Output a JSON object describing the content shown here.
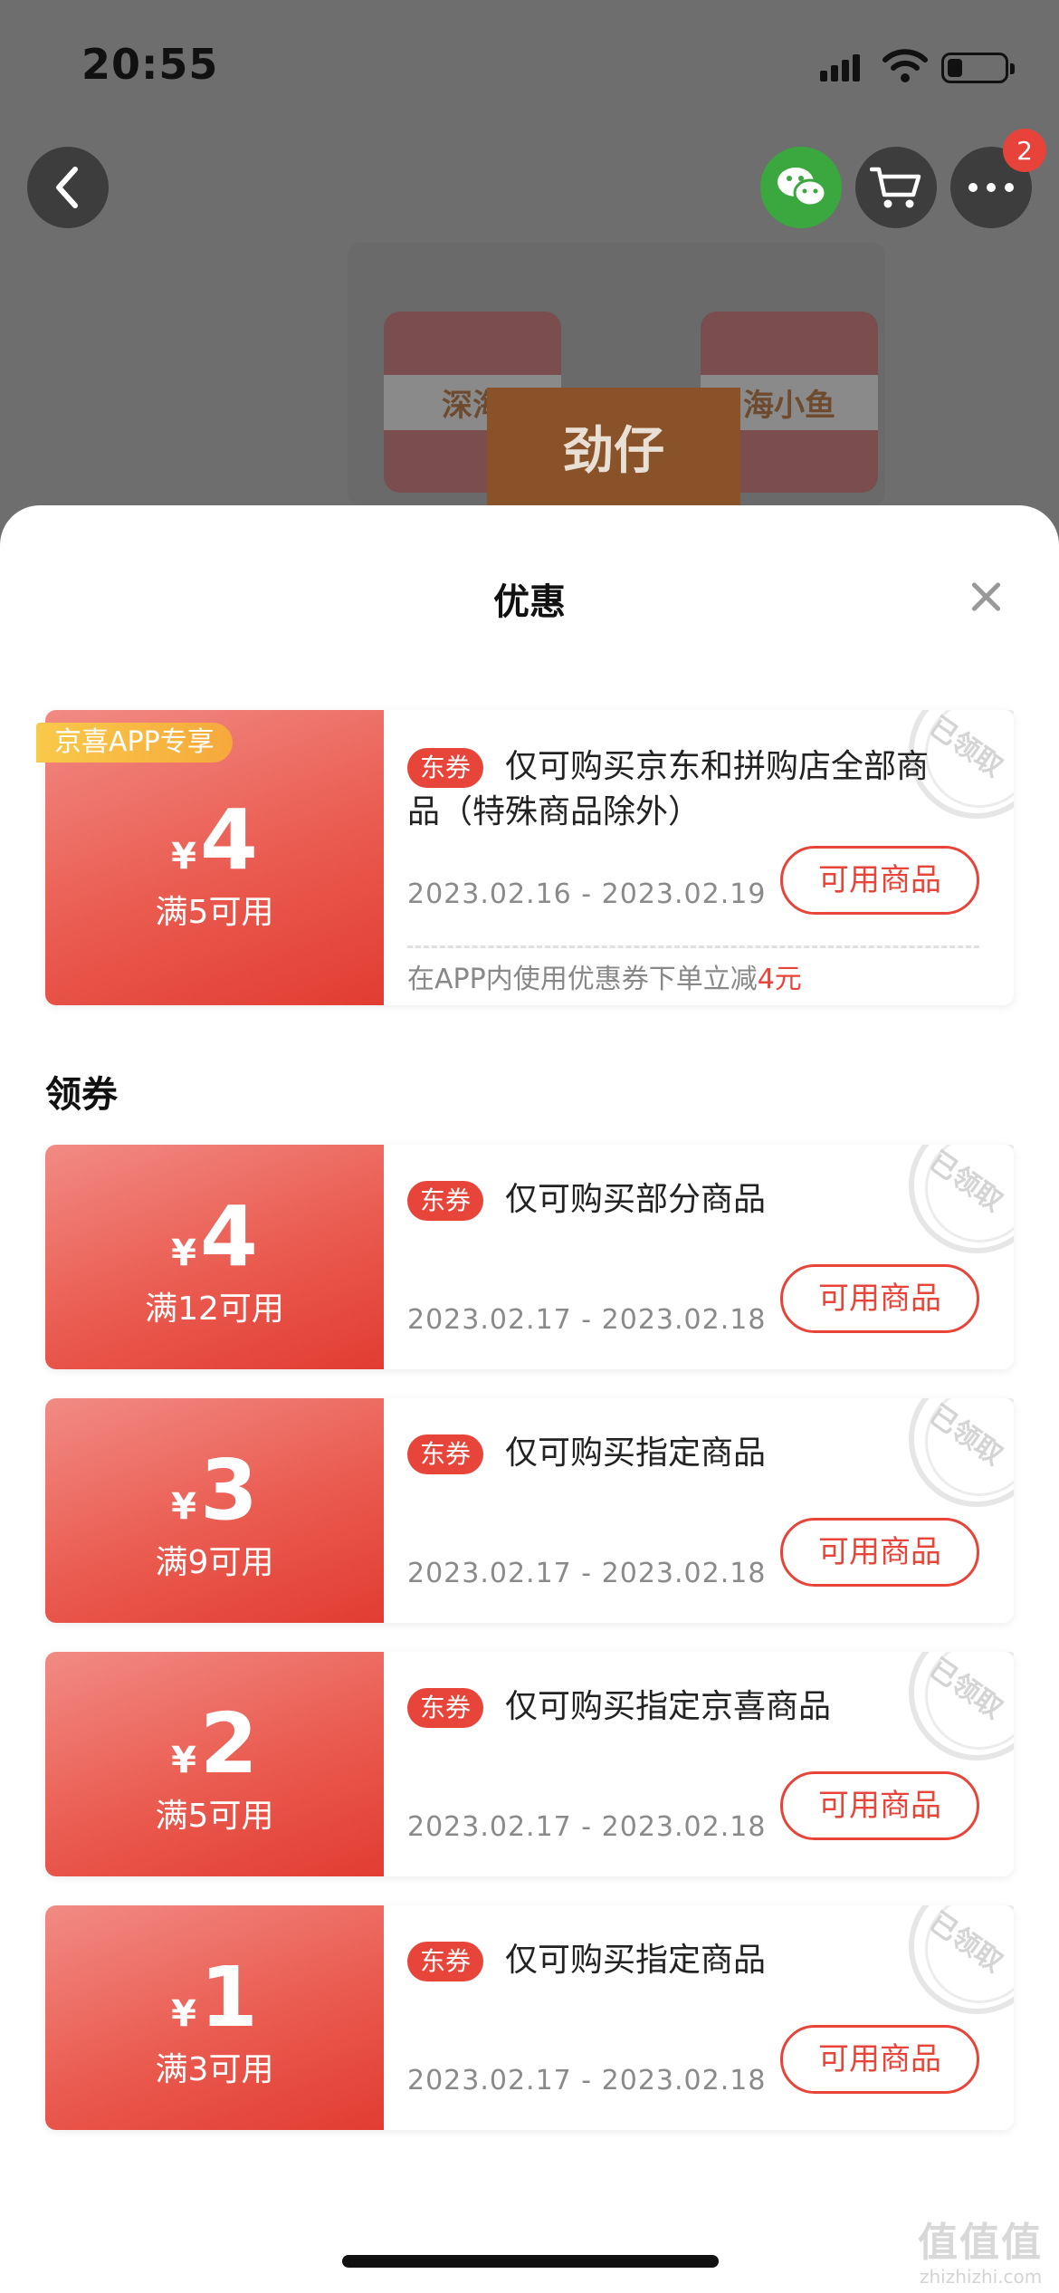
{
  "status_bar": {
    "time": "20:55"
  },
  "header": {
    "more_badge": "2",
    "product_brand": "劲仔",
    "product_labels": [
      "深海",
      "海小鱼"
    ]
  },
  "sheet": {
    "title": "优惠",
    "featured_coupon": {
      "tag": "京喜APP专享",
      "currency": "¥",
      "amount": "4",
      "condition": "满5可用",
      "type_tag": "东券",
      "description": "仅可购买京东和拼购店全部商品（特殊商品除外）",
      "date_range": "2023.02.16 - 2023.02.19",
      "button": "可用商品",
      "stamp": "已领取",
      "note_prefix": "在APP内使用优惠券下单立减",
      "note_highlight": "4元"
    },
    "section_title": "领券",
    "coupons": [
      {
        "currency": "¥",
        "amount": "4",
        "condition": "满12可用",
        "type_tag": "东券",
        "description": "仅可购买部分商品",
        "date_range": "2023.02.17 - 2023.02.18",
        "button": "可用商品",
        "stamp": "已领取"
      },
      {
        "currency": "¥",
        "amount": "3",
        "condition": "满9可用",
        "type_tag": "东券",
        "description": "仅可购买指定商品",
        "date_range": "2023.02.17 - 2023.02.18",
        "button": "可用商品",
        "stamp": "已领取"
      },
      {
        "currency": "¥",
        "amount": "2",
        "condition": "满5可用",
        "type_tag": "东券",
        "description": "仅可购买指定京喜商品",
        "date_range": "2023.02.17 - 2023.02.18",
        "button": "可用商品",
        "stamp": "已领取"
      },
      {
        "currency": "¥",
        "amount": "1",
        "condition": "满3可用",
        "type_tag": "东券",
        "description": "仅可购买指定商品",
        "date_range": "2023.02.17 - 2023.02.18",
        "button": "可用商品",
        "stamp": "已领取"
      }
    ]
  },
  "watermark": {
    "text": "值值值",
    "sub": "zhizhizhi.com"
  },
  "colors": {
    "accent": "#e8453a",
    "coupon_gradient_start": "#f18b84",
    "coupon_gradient_end": "#e23c31",
    "app_tag": "#f9c94a",
    "wechat": "#3aa83f"
  },
  "icons": [
    "back-icon",
    "wechat-icon",
    "cart-icon",
    "more-icon",
    "close-icon",
    "signal-icon",
    "wifi-icon",
    "battery-icon"
  ]
}
